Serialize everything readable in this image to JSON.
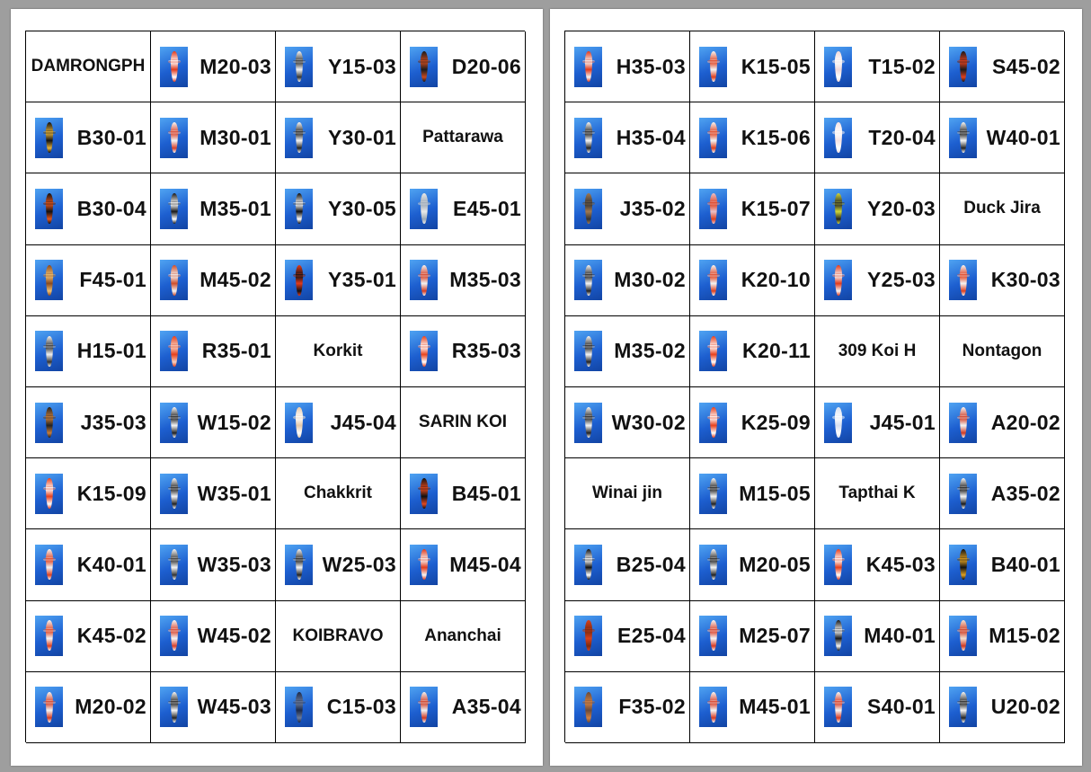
{
  "left_page": {
    "cells": [
      {
        "type": "name",
        "text": "DAMRONGPH"
      },
      {
        "type": "code",
        "text": "M20-03",
        "fish": [
          "#e23a1c",
          "#ffffff"
        ]
      },
      {
        "type": "code",
        "text": "Y15-03",
        "fish": [
          "#f4f4f4",
          "#333333"
        ]
      },
      {
        "type": "code",
        "text": "D20-06",
        "fish": [
          "#1b1b1b",
          "#c94a1e"
        ]
      },
      {
        "type": "code",
        "text": "B30-01",
        "fish": [
          "#111111",
          "#e7b33a"
        ]
      },
      {
        "type": "code",
        "text": "M30-01",
        "fish": [
          "#f3f3f3",
          "#d8412a"
        ]
      },
      {
        "type": "code",
        "text": "Y30-01",
        "fish": [
          "#f5f5f5",
          "#222222"
        ]
      },
      {
        "type": "name",
        "text": "Pattarawa"
      },
      {
        "type": "code",
        "text": "B30-04",
        "fish": [
          "#111111",
          "#e5551b"
        ]
      },
      {
        "type": "code",
        "text": "M35-01",
        "fish": [
          "#1a1a1a",
          "#ffffff"
        ]
      },
      {
        "type": "code",
        "text": "Y30-05",
        "fish": [
          "#0f0f0f",
          "#ffffff"
        ]
      },
      {
        "type": "code",
        "text": "E45-01",
        "fish": [
          "#e8e8e8",
          "#9aa7b5"
        ]
      },
      {
        "type": "code",
        "text": "F45-01",
        "fish": [
          "#8a4a20",
          "#f0c070"
        ]
      },
      {
        "type": "code",
        "text": "M45-02",
        "fish": [
          "#cf4d2a",
          "#f3f3f3"
        ]
      },
      {
        "type": "code",
        "text": "Y35-01",
        "fish": [
          "#e23a1c",
          "#111111"
        ]
      },
      {
        "type": "code",
        "text": "M35-03",
        "fish": [
          "#f2f2f2",
          "#d43c22"
        ]
      },
      {
        "type": "code",
        "text": "H15-01",
        "fish": [
          "#f0f0f0",
          "#333333"
        ]
      },
      {
        "type": "code",
        "text": "R35-01",
        "fish": [
          "#e6401c",
          "#f5d0c0"
        ]
      },
      {
        "type": "name",
        "text": "Korkit"
      },
      {
        "type": "code",
        "text": "R35-03",
        "fish": [
          "#e8431e",
          "#ffffff"
        ]
      },
      {
        "type": "code",
        "text": "J35-03",
        "fish": [
          "#222222",
          "#c87d3a"
        ]
      },
      {
        "type": "code",
        "text": "W15-02",
        "fish": [
          "#f5f5f5",
          "#222222"
        ]
      },
      {
        "type": "code",
        "text": "J45-04",
        "fish": [
          "#e6c8a8",
          "#ffffff"
        ]
      },
      {
        "type": "name",
        "text": "SARIN KOI"
      },
      {
        "type": "code",
        "text": "K15-09",
        "fish": [
          "#e8401c",
          "#ffffff"
        ]
      },
      {
        "type": "code",
        "text": "W35-01",
        "fish": [
          "#f5f5f5",
          "#222222"
        ]
      },
      {
        "type": "name",
        "text": "Chakkrit"
      },
      {
        "type": "code",
        "text": "B45-01",
        "fish": [
          "#111111",
          "#e4481e"
        ]
      },
      {
        "type": "code",
        "text": "K40-01",
        "fish": [
          "#f2f2f2",
          "#e0401e"
        ]
      },
      {
        "type": "code",
        "text": "W35-03",
        "fish": [
          "#f5f5f5",
          "#333333"
        ]
      },
      {
        "type": "code",
        "text": "W25-03",
        "fish": [
          "#f3f3f3",
          "#222222"
        ]
      },
      {
        "type": "code",
        "text": "M45-04",
        "fish": [
          "#e23a1c",
          "#f5f5f5"
        ]
      },
      {
        "type": "code",
        "text": "K45-02",
        "fish": [
          "#f5f5f5",
          "#e0401e"
        ]
      },
      {
        "type": "code",
        "text": "W45-02",
        "fish": [
          "#f5f5f5",
          "#d8402a"
        ]
      },
      {
        "type": "name",
        "text": "KOIBRAVO"
      },
      {
        "type": "name",
        "text": "Ananchai"
      },
      {
        "type": "code",
        "text": "M20-02",
        "fish": [
          "#f3f3f3",
          "#d43c22"
        ]
      },
      {
        "type": "code",
        "text": "W45-03",
        "fish": [
          "#f5f5f5",
          "#222222"
        ]
      },
      {
        "type": "code",
        "text": "C15-03",
        "fish": [
          "#1c2a4a",
          "#6a7a9a"
        ]
      },
      {
        "type": "code",
        "text": "A35-04",
        "fish": [
          "#f0f0f0",
          "#d03a22"
        ]
      }
    ]
  },
  "right_page": {
    "cells": [
      {
        "type": "code",
        "text": "H35-03",
        "fish": [
          "#e23a1c",
          "#f5f5f5"
        ]
      },
      {
        "type": "code",
        "text": "K15-05",
        "fish": [
          "#f3f3f3",
          "#e0401e"
        ]
      },
      {
        "type": "code",
        "text": "T15-02",
        "fish": [
          "#f0d8d8",
          "#ffffff"
        ]
      },
      {
        "type": "code",
        "text": "S45-02",
        "fish": [
          "#1a1a1a",
          "#e0401e"
        ]
      },
      {
        "type": "code",
        "text": "H35-04",
        "fish": [
          "#f5f5f5",
          "#222222"
        ]
      },
      {
        "type": "code",
        "text": "K15-06",
        "fish": [
          "#f3f3f3",
          "#e0401e"
        ]
      },
      {
        "type": "code",
        "text": "T20-04",
        "fish": [
          "#f5e2e2",
          "#ffffff"
        ]
      },
      {
        "type": "code",
        "text": "W40-01",
        "fish": [
          "#f5f5f5",
          "#222222"
        ]
      },
      {
        "type": "code",
        "text": "J35-02",
        "fish": [
          "#a07850",
          "#333333"
        ]
      },
      {
        "type": "code",
        "text": "K15-07",
        "fish": [
          "#e8c0c8",
          "#e0401e"
        ]
      },
      {
        "type": "code",
        "text": "Y20-03",
        "fish": [
          "#cfd63a",
          "#222222"
        ]
      },
      {
        "type": "name",
        "text": "Duck Jira"
      },
      {
        "type": "code",
        "text": "M30-02",
        "fish": [
          "#f5f5f5",
          "#222222"
        ]
      },
      {
        "type": "code",
        "text": "K20-10",
        "fish": [
          "#f3f3f3",
          "#e0401e"
        ]
      },
      {
        "type": "code",
        "text": "Y25-03",
        "fish": [
          "#e23a1c",
          "#f5f5f5"
        ]
      },
      {
        "type": "code",
        "text": "K30-03",
        "fish": [
          "#f3f3f3",
          "#e0401e"
        ]
      },
      {
        "type": "code",
        "text": "M35-02",
        "fish": [
          "#f5f5f5",
          "#222222"
        ]
      },
      {
        "type": "code",
        "text": "K20-11",
        "fish": [
          "#e8401c",
          "#ffffff"
        ]
      },
      {
        "type": "name",
        "text": "309 Koi H"
      },
      {
        "type": "name",
        "text": "Nontagon"
      },
      {
        "type": "code",
        "text": "W30-02",
        "fish": [
          "#f5f5f5",
          "#222222"
        ]
      },
      {
        "type": "code",
        "text": "K25-09",
        "fish": [
          "#e8401c",
          "#ffffff"
        ]
      },
      {
        "type": "code",
        "text": "J45-01",
        "fish": [
          "#d8e0f0",
          "#ffffff"
        ]
      },
      {
        "type": "code",
        "text": "A20-02",
        "fish": [
          "#f3f3f3",
          "#d03a22"
        ]
      },
      {
        "type": "name",
        "text": "Winai jin"
      },
      {
        "type": "code",
        "text": "M15-05",
        "fish": [
          "#f5f5f5",
          "#222222"
        ]
      },
      {
        "type": "name",
        "text": "Tapthai K"
      },
      {
        "type": "code",
        "text": "A35-02",
        "fish": [
          "#f5f5f5",
          "#1a1a1a"
        ]
      },
      {
        "type": "code",
        "text": "B25-04",
        "fish": [
          "#111111",
          "#ffffff"
        ]
      },
      {
        "type": "code",
        "text": "M20-05",
        "fish": [
          "#f5f5f5",
          "#222222"
        ]
      },
      {
        "type": "code",
        "text": "K45-03",
        "fish": [
          "#e8401c",
          "#ffffff"
        ]
      },
      {
        "type": "code",
        "text": "B40-01",
        "fish": [
          "#111111",
          "#e0a020"
        ]
      },
      {
        "type": "code",
        "text": "E25-04",
        "fish": [
          "#d8401c",
          "#7a2a10"
        ]
      },
      {
        "type": "code",
        "text": "M25-07",
        "fish": [
          "#f5f5f5",
          "#d83a22"
        ]
      },
      {
        "type": "code",
        "text": "M40-01",
        "fish": [
          "#1a1a1a",
          "#f5f5f5"
        ]
      },
      {
        "type": "code",
        "text": "M15-02",
        "fish": [
          "#f3e0d0",
          "#d03a22"
        ]
      },
      {
        "type": "code",
        "text": "F35-02",
        "fish": [
          "#6a4a3a",
          "#d08040"
        ]
      },
      {
        "type": "code",
        "text": "M45-01",
        "fish": [
          "#f5f5f5",
          "#d83a22"
        ]
      },
      {
        "type": "code",
        "text": "S40-01",
        "fish": [
          "#f5f5f5",
          "#d83a22"
        ]
      },
      {
        "type": "code",
        "text": "U20-02",
        "fish": [
          "#f5f5f5",
          "#222222"
        ]
      }
    ]
  }
}
